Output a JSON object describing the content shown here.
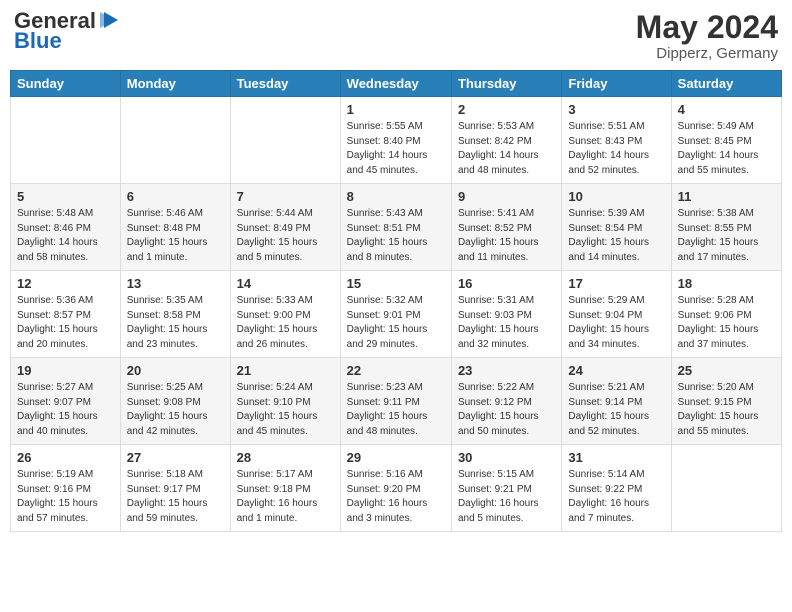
{
  "header": {
    "logo": {
      "general": "General",
      "blue": "Blue"
    },
    "title": "May 2024",
    "location": "Dipperz, Germany"
  },
  "weekdays": [
    "Sunday",
    "Monday",
    "Tuesday",
    "Wednesday",
    "Thursday",
    "Friday",
    "Saturday"
  ],
  "weeks": [
    [
      {
        "day": "",
        "sunrise": "",
        "sunset": "",
        "daylight": ""
      },
      {
        "day": "",
        "sunrise": "",
        "sunset": "",
        "daylight": ""
      },
      {
        "day": "",
        "sunrise": "",
        "sunset": "",
        "daylight": ""
      },
      {
        "day": "1",
        "sunrise": "Sunrise: 5:55 AM",
        "sunset": "Sunset: 8:40 PM",
        "daylight": "Daylight: 14 hours and 45 minutes."
      },
      {
        "day": "2",
        "sunrise": "Sunrise: 5:53 AM",
        "sunset": "Sunset: 8:42 PM",
        "daylight": "Daylight: 14 hours and 48 minutes."
      },
      {
        "day": "3",
        "sunrise": "Sunrise: 5:51 AM",
        "sunset": "Sunset: 8:43 PM",
        "daylight": "Daylight: 14 hours and 52 minutes."
      },
      {
        "day": "4",
        "sunrise": "Sunrise: 5:49 AM",
        "sunset": "Sunset: 8:45 PM",
        "daylight": "Daylight: 14 hours and 55 minutes."
      }
    ],
    [
      {
        "day": "5",
        "sunrise": "Sunrise: 5:48 AM",
        "sunset": "Sunset: 8:46 PM",
        "daylight": "Daylight: 14 hours and 58 minutes."
      },
      {
        "day": "6",
        "sunrise": "Sunrise: 5:46 AM",
        "sunset": "Sunset: 8:48 PM",
        "daylight": "Daylight: 15 hours and 1 minute."
      },
      {
        "day": "7",
        "sunrise": "Sunrise: 5:44 AM",
        "sunset": "Sunset: 8:49 PM",
        "daylight": "Daylight: 15 hours and 5 minutes."
      },
      {
        "day": "8",
        "sunrise": "Sunrise: 5:43 AM",
        "sunset": "Sunset: 8:51 PM",
        "daylight": "Daylight: 15 hours and 8 minutes."
      },
      {
        "day": "9",
        "sunrise": "Sunrise: 5:41 AM",
        "sunset": "Sunset: 8:52 PM",
        "daylight": "Daylight: 15 hours and 11 minutes."
      },
      {
        "day": "10",
        "sunrise": "Sunrise: 5:39 AM",
        "sunset": "Sunset: 8:54 PM",
        "daylight": "Daylight: 15 hours and 14 minutes."
      },
      {
        "day": "11",
        "sunrise": "Sunrise: 5:38 AM",
        "sunset": "Sunset: 8:55 PM",
        "daylight": "Daylight: 15 hours and 17 minutes."
      }
    ],
    [
      {
        "day": "12",
        "sunrise": "Sunrise: 5:36 AM",
        "sunset": "Sunset: 8:57 PM",
        "daylight": "Daylight: 15 hours and 20 minutes."
      },
      {
        "day": "13",
        "sunrise": "Sunrise: 5:35 AM",
        "sunset": "Sunset: 8:58 PM",
        "daylight": "Daylight: 15 hours and 23 minutes."
      },
      {
        "day": "14",
        "sunrise": "Sunrise: 5:33 AM",
        "sunset": "Sunset: 9:00 PM",
        "daylight": "Daylight: 15 hours and 26 minutes."
      },
      {
        "day": "15",
        "sunrise": "Sunrise: 5:32 AM",
        "sunset": "Sunset: 9:01 PM",
        "daylight": "Daylight: 15 hours and 29 minutes."
      },
      {
        "day": "16",
        "sunrise": "Sunrise: 5:31 AM",
        "sunset": "Sunset: 9:03 PM",
        "daylight": "Daylight: 15 hours and 32 minutes."
      },
      {
        "day": "17",
        "sunrise": "Sunrise: 5:29 AM",
        "sunset": "Sunset: 9:04 PM",
        "daylight": "Daylight: 15 hours and 34 minutes."
      },
      {
        "day": "18",
        "sunrise": "Sunrise: 5:28 AM",
        "sunset": "Sunset: 9:06 PM",
        "daylight": "Daylight: 15 hours and 37 minutes."
      }
    ],
    [
      {
        "day": "19",
        "sunrise": "Sunrise: 5:27 AM",
        "sunset": "Sunset: 9:07 PM",
        "daylight": "Daylight: 15 hours and 40 minutes."
      },
      {
        "day": "20",
        "sunrise": "Sunrise: 5:25 AM",
        "sunset": "Sunset: 9:08 PM",
        "daylight": "Daylight: 15 hours and 42 minutes."
      },
      {
        "day": "21",
        "sunrise": "Sunrise: 5:24 AM",
        "sunset": "Sunset: 9:10 PM",
        "daylight": "Daylight: 15 hours and 45 minutes."
      },
      {
        "day": "22",
        "sunrise": "Sunrise: 5:23 AM",
        "sunset": "Sunset: 9:11 PM",
        "daylight": "Daylight: 15 hours and 48 minutes."
      },
      {
        "day": "23",
        "sunrise": "Sunrise: 5:22 AM",
        "sunset": "Sunset: 9:12 PM",
        "daylight": "Daylight: 15 hours and 50 minutes."
      },
      {
        "day": "24",
        "sunrise": "Sunrise: 5:21 AM",
        "sunset": "Sunset: 9:14 PM",
        "daylight": "Daylight: 15 hours and 52 minutes."
      },
      {
        "day": "25",
        "sunrise": "Sunrise: 5:20 AM",
        "sunset": "Sunset: 9:15 PM",
        "daylight": "Daylight: 15 hours and 55 minutes."
      }
    ],
    [
      {
        "day": "26",
        "sunrise": "Sunrise: 5:19 AM",
        "sunset": "Sunset: 9:16 PM",
        "daylight": "Daylight: 15 hours and 57 minutes."
      },
      {
        "day": "27",
        "sunrise": "Sunrise: 5:18 AM",
        "sunset": "Sunset: 9:17 PM",
        "daylight": "Daylight: 15 hours and 59 minutes."
      },
      {
        "day": "28",
        "sunrise": "Sunrise: 5:17 AM",
        "sunset": "Sunset: 9:18 PM",
        "daylight": "Daylight: 16 hours and 1 minute."
      },
      {
        "day": "29",
        "sunrise": "Sunrise: 5:16 AM",
        "sunset": "Sunset: 9:20 PM",
        "daylight": "Daylight: 16 hours and 3 minutes."
      },
      {
        "day": "30",
        "sunrise": "Sunrise: 5:15 AM",
        "sunset": "Sunset: 9:21 PM",
        "daylight": "Daylight: 16 hours and 5 minutes."
      },
      {
        "day": "31",
        "sunrise": "Sunrise: 5:14 AM",
        "sunset": "Sunset: 9:22 PM",
        "daylight": "Daylight: 16 hours and 7 minutes."
      },
      {
        "day": "",
        "sunrise": "",
        "sunset": "",
        "daylight": ""
      }
    ]
  ]
}
